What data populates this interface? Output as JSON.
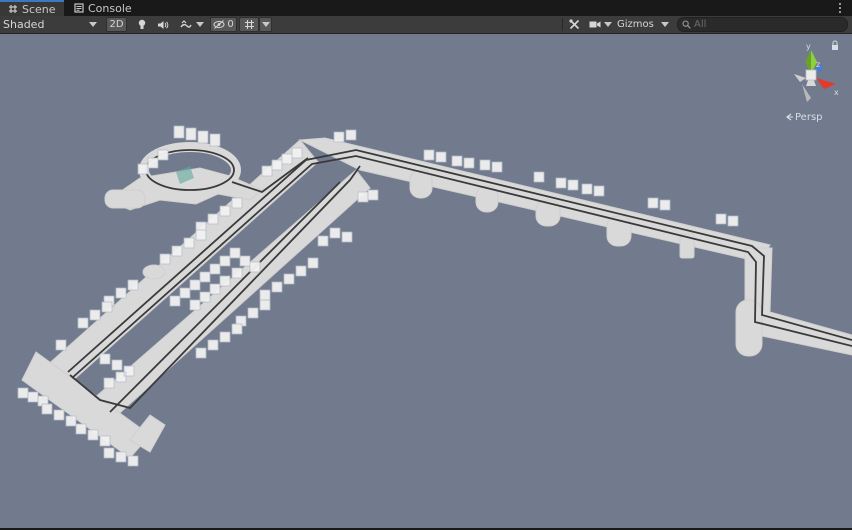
{
  "tabs": [
    {
      "label": "Scene",
      "icon": "hash-grid-icon",
      "active": true
    },
    {
      "label": "Console",
      "icon": "console-icon",
      "active": false
    }
  ],
  "toolbar": {
    "draw_mode": "Shaded",
    "toggle_2d": "2D",
    "hidden_count": "0",
    "gizmos_label": "Gizmos",
    "search_placeholder": "All"
  },
  "scene": {
    "projection_label": "Persp",
    "axis_x": "x",
    "axis_y": "y",
    "axis_z": "z",
    "background_color": "#717b8d",
    "road_color": "#dcdcdc",
    "track_line_color": "#3a3a3a"
  },
  "colors": {
    "panel": "#3c3c3c",
    "tab_active": "#383838",
    "accent": "#3a79bb",
    "gizmo_x": "#e23b2e",
    "gizmo_y": "#8ad13c",
    "gizmo_z": "#3d7ee3"
  }
}
